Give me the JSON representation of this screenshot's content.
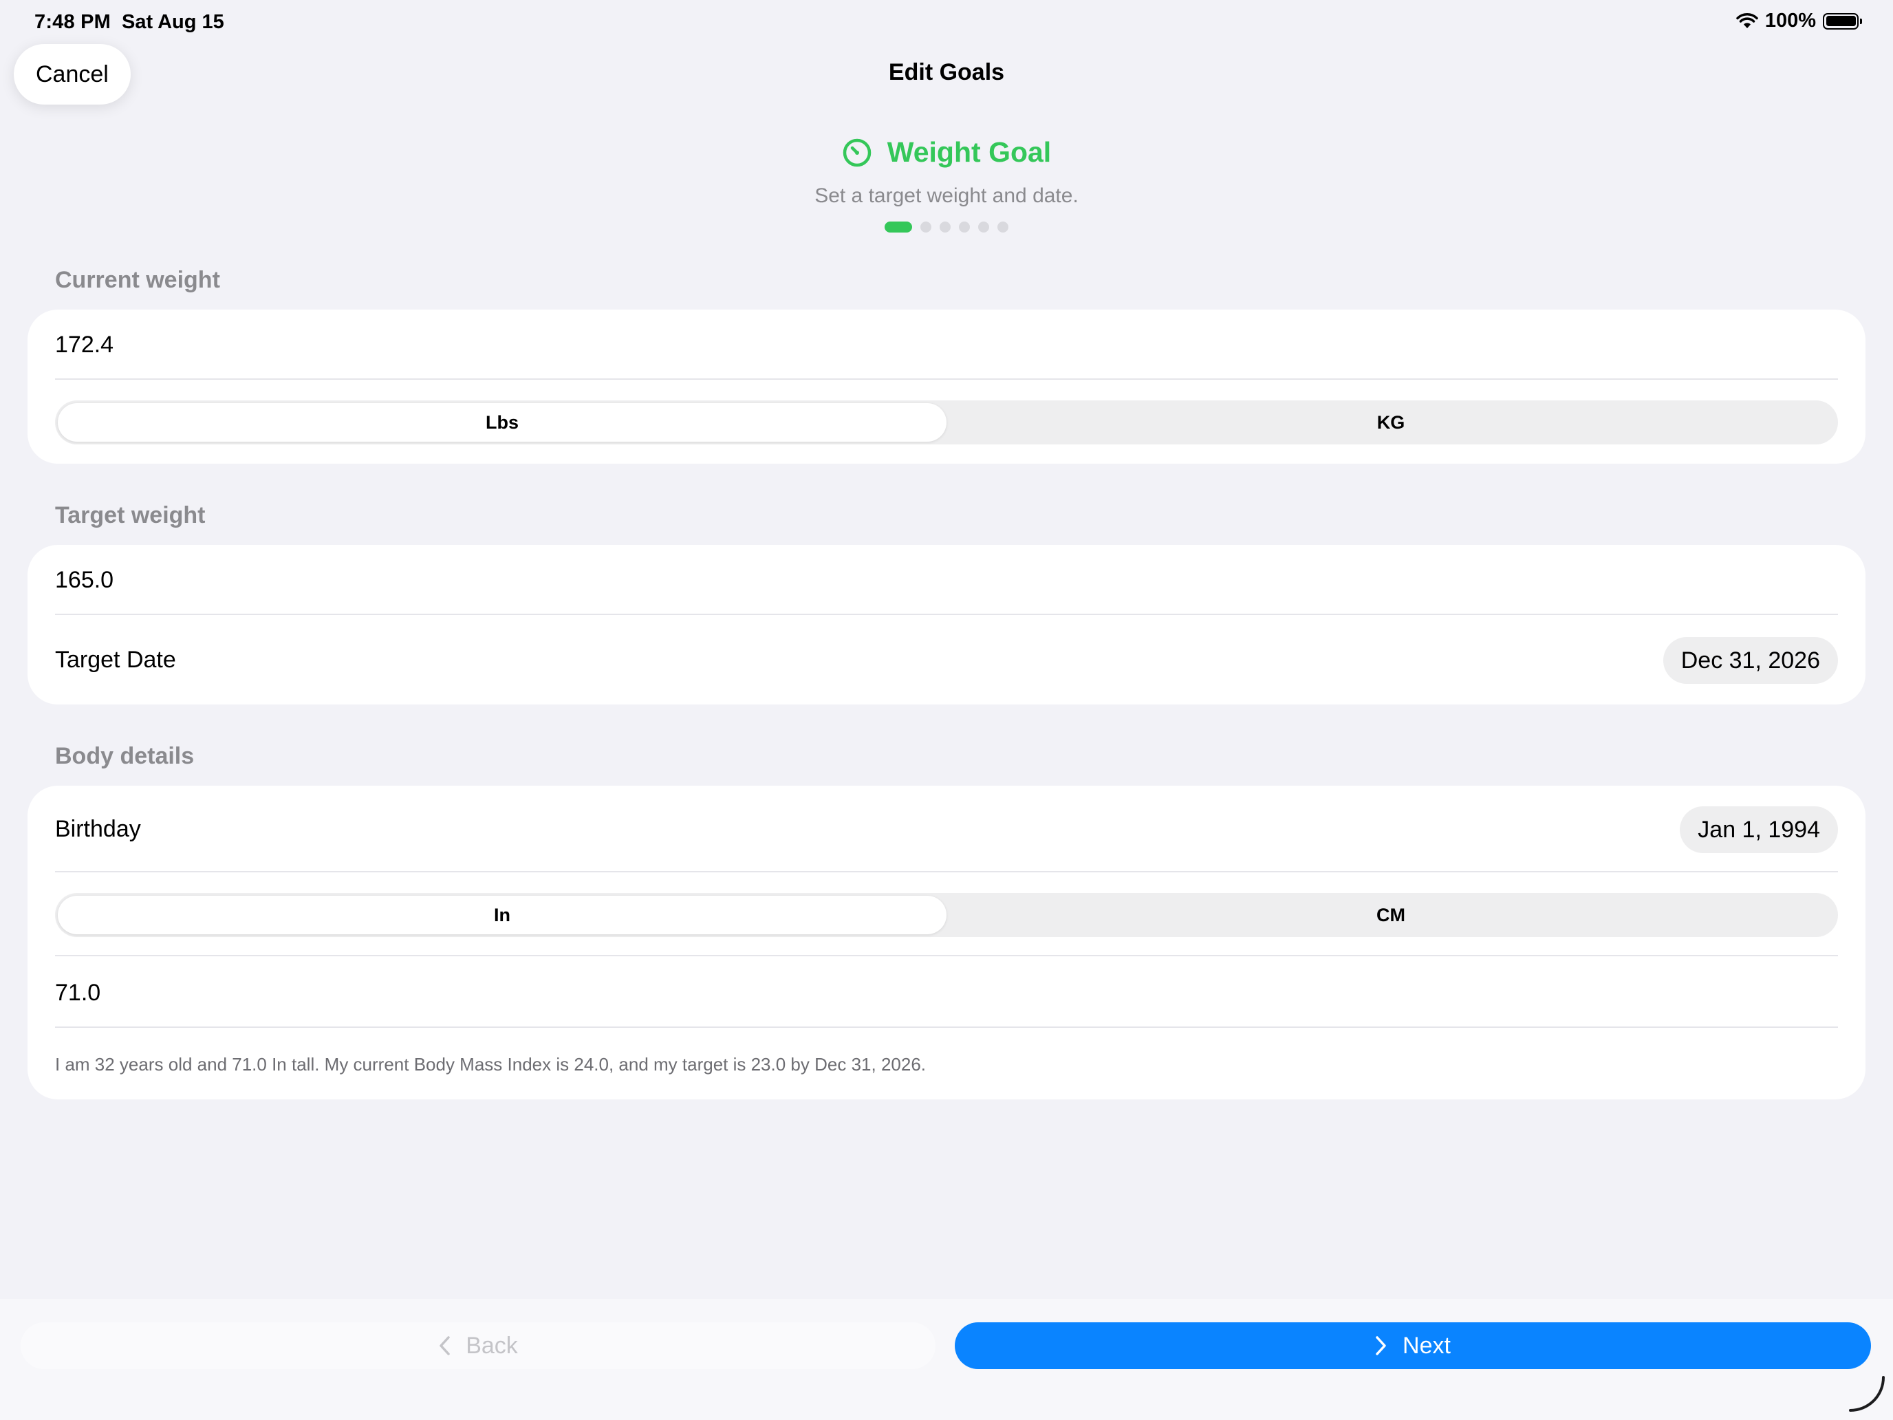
{
  "status_bar": {
    "time": "7:48 PM",
    "date": "Sat Aug 15",
    "battery": "100%",
    "icons": [
      "wifi-icon",
      "battery-icon"
    ]
  },
  "nav": {
    "cancel_label": "Cancel",
    "title": "Edit Goals"
  },
  "goal": {
    "icon": "gauge-icon",
    "title": "Weight Goal",
    "subtitle": "Set a target weight and date.",
    "step_current": 1,
    "step_total": 6
  },
  "current_weight": {
    "label": "Current weight",
    "value": "172.4",
    "units": [
      "Lbs",
      "KG"
    ],
    "selected_unit": "Lbs"
  },
  "target_weight": {
    "label": "Target weight",
    "value": "165.0",
    "date_label": "Target Date",
    "date_value": "Dec 31, 2026"
  },
  "body_details": {
    "label": "Body details",
    "birthday_label": "Birthday",
    "birthday_value": "Jan 1, 1994",
    "height_units": [
      "In",
      "CM"
    ],
    "selected_height_unit": "In",
    "height_value": "71.0",
    "summary": "I am 32 years old and 71.0 In tall. My current Body Mass Index is 24.0, and my target is 23.0 by Dec 31, 2026."
  },
  "footer": {
    "back_label": "Back",
    "next_label": "Next"
  },
  "colors": {
    "accent_green": "#34c759",
    "primary_blue": "#0a84ff",
    "background": "#f2f2f7"
  }
}
